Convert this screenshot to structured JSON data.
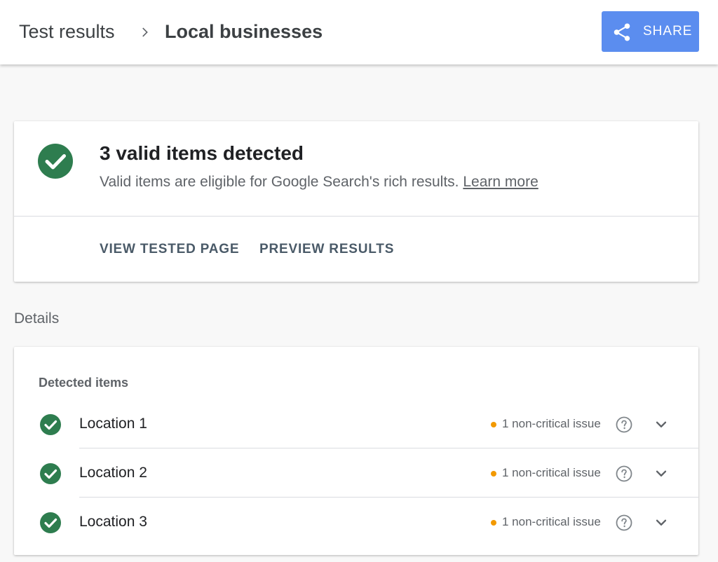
{
  "header": {
    "breadcrumb_root": "Test results",
    "breadcrumb_current": "Local businesses",
    "share_label": "SHARE"
  },
  "summary": {
    "title": "3 valid items detected",
    "description": "Valid items are eligible for Google Search's rich results.",
    "learn_more": "Learn more",
    "actions": {
      "view_tested_page": "VIEW TESTED PAGE",
      "preview_results": "PREVIEW RESULTS"
    }
  },
  "details": {
    "label": "Details",
    "detected_items_header": "Detected items",
    "items": [
      {
        "label": "Location 1",
        "issue": "1 non-critical issue"
      },
      {
        "label": "Location 2",
        "issue": "1 non-critical issue"
      },
      {
        "label": "Location 3",
        "issue": "1 non-critical issue"
      }
    ]
  },
  "colors": {
    "accent_blue": "#5b8def",
    "valid_green": "#2e7d4f",
    "warning_orange": "#f29900"
  },
  "icons": {
    "share": "share-icon",
    "valid": "check-circle-icon",
    "help": "help-circle-icon",
    "expand": "chevron-down-icon",
    "breadcrumb_separator": "chevron-right-icon"
  }
}
